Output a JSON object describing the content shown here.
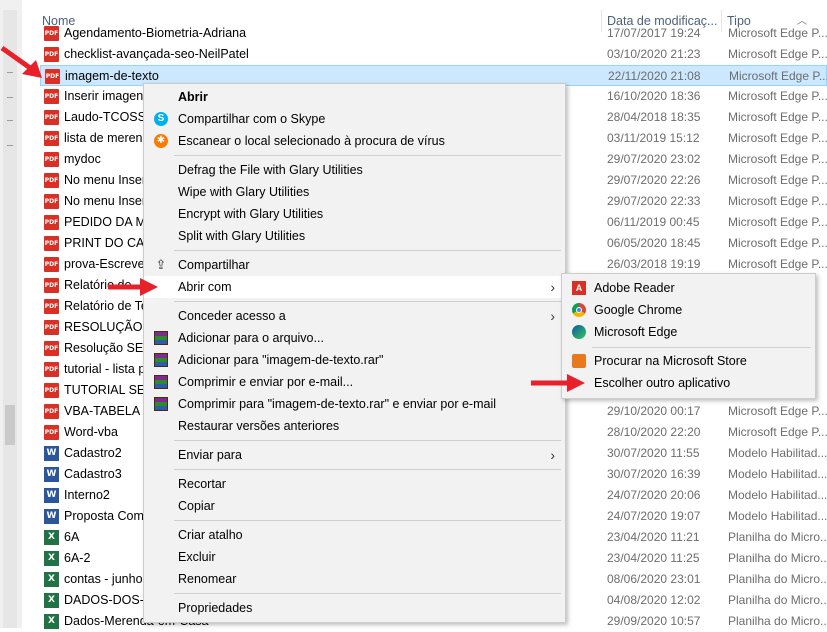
{
  "header": {
    "name_label": "Nome",
    "date_label": "Data de modificaç...",
    "type_label": "Tipo"
  },
  "files": [
    {
      "name": "Agendamento-Biometria-Adriana",
      "date": "17/07/2017 19:24",
      "type": "Microsoft Edge P...",
      "icon": "pdf-icon"
    },
    {
      "name": "checklist-avançada-seo-NeilPatel",
      "date": "03/10/2020 21:23",
      "type": "Microsoft Edge P...",
      "icon": "pdf-icon"
    },
    {
      "name": "imagem-de-texto",
      "date": "22/11/2020 21:08",
      "type": "Microsoft Edge P...",
      "icon": "pdf-icon",
      "selected": true
    },
    {
      "name": "Inserir imagens",
      "date": "16/10/2020 18:36",
      "type": "Microsoft Edge P...",
      "icon": "pdf-icon"
    },
    {
      "name": "Laudo-TCOSSO",
      "date": "28/04/2018 18:35",
      "type": "Microsoft Edge P...",
      "icon": "pdf-icon"
    },
    {
      "name": "lista de merend",
      "date": "03/11/2019 15:12",
      "type": "Microsoft Edge P...",
      "icon": "pdf-icon"
    },
    {
      "name": "mydoc",
      "date": "29/07/2020 23:02",
      "type": "Microsoft Edge P...",
      "icon": "pdf-icon"
    },
    {
      "name": "No menu Inser",
      "date": "29/07/2020 22:26",
      "type": "Microsoft Edge P...",
      "icon": "pdf-icon"
    },
    {
      "name": "No menu Inser",
      "date": "29/07/2020 22:33",
      "type": "Microsoft Edge P...",
      "icon": "pdf-icon"
    },
    {
      "name": "PEDIDO DA ME",
      "date": "06/11/2019 00:45",
      "type": "Microsoft Edge P...",
      "icon": "pdf-icon"
    },
    {
      "name": "PRINT DO CAL",
      "date": "06/05/2020 18:45",
      "type": "Microsoft Edge P...",
      "icon": "pdf-icon"
    },
    {
      "name": "prova-Escrever",
      "date": "26/03/2018 19:19",
      "type": "Microsoft Edge P...",
      "icon": "pdf-icon"
    },
    {
      "name": "Relatório de",
      "date": "",
      "type": "",
      "icon": "pdf-icon"
    },
    {
      "name": "Relatório de Te",
      "date": "",
      "type": "",
      "icon": "pdf-icon"
    },
    {
      "name": "RESOLUÇÃO SE",
      "date": "",
      "type": "",
      "icon": "pdf-icon"
    },
    {
      "name": "Resolução SE-S",
      "date": "",
      "type": "",
      "icon": "pdf-icon"
    },
    {
      "name": "tutorial - lista p",
      "date": "",
      "type": "",
      "icon": "pdf-icon"
    },
    {
      "name": "TUTORIAL SED",
      "date": "",
      "type": "",
      "icon": "pdf-icon"
    },
    {
      "name": "VBA-TABELA FI",
      "date": "29/10/2020 00:17",
      "type": "Microsoft Edge P...",
      "icon": "pdf-icon"
    },
    {
      "name": "Word-vba",
      "date": "28/10/2020 22:20",
      "type": "Microsoft Edge P...",
      "icon": "pdf-icon"
    },
    {
      "name": "Cadastro2",
      "date": "30/07/2020 11:55",
      "type": "Modelo Habilitad...",
      "icon": "word-icon"
    },
    {
      "name": "Cadastro3",
      "date": "30/07/2020 16:39",
      "type": "Modelo Habilitad...",
      "icon": "word-icon"
    },
    {
      "name": "Interno2",
      "date": "24/07/2020 20:06",
      "type": "Modelo Habilitad...",
      "icon": "word-icon"
    },
    {
      "name": "Proposta Come",
      "date": "24/07/2020 19:07",
      "type": "Modelo Habilitad...",
      "icon": "word-icon"
    },
    {
      "name": "6A",
      "date": "23/04/2020 11:21",
      "type": "Planilha do Micro...",
      "icon": "excel-icon"
    },
    {
      "name": "6A-2",
      "date": "23/04/2020 11:25",
      "type": "Planilha do Micro...",
      "icon": "excel-icon"
    },
    {
      "name": "contas - junho",
      "date": "08/06/2020 23:01",
      "type": "Planilha do Micro...",
      "icon": "excel-icon"
    },
    {
      "name": "DADOS-DOS-A",
      "date": "04/08/2020 12:02",
      "type": "Planilha do Micro...",
      "icon": "excel-icon"
    },
    {
      "name": "Dados-Merenda-em-Casa",
      "date": "29/09/2020 10:57",
      "type": "Planilha do Micro...",
      "icon": "excel-icon"
    }
  ],
  "context_menu": {
    "open": "Abrir",
    "share_skype": "Compartilhar com o Skype",
    "scan_virus": "Escanear o local selecionado à procura de vírus",
    "defrag": "Defrag the File with Glary Utilities",
    "wipe": "Wipe with Glary Utilities",
    "encrypt": "Encrypt with Glary Utilities",
    "split": "Split with Glary Utilities",
    "share": "Compartilhar",
    "open_with": "Abrir com",
    "grant_access": "Conceder acesso a",
    "add_archive": "Adicionar para o arquivo...",
    "add_rar": "Adicionar para \"imagem-de-texto.rar\"",
    "compress_email": "Comprimir e enviar por e-mail...",
    "compress_rar_email": "Comprimir para \"imagem-de-texto.rar\" e enviar por e-mail",
    "restore": "Restaurar versões anteriores",
    "send_to": "Enviar para",
    "cut": "Recortar",
    "copy": "Copiar",
    "shortcut": "Criar atalho",
    "delete": "Excluir",
    "rename": "Renomear",
    "properties": "Propriedades"
  },
  "open_with_menu": {
    "adobe": "Adobe Reader",
    "chrome": "Google Chrome",
    "edge": "Microsoft Edge",
    "store": "Procurar na Microsoft Store",
    "other": "Escolher outro aplicativo"
  },
  "colors": {
    "arrow_red": "#e8202a",
    "selection": "#cce8ff",
    "menu_bg": "#f2f2f2"
  }
}
